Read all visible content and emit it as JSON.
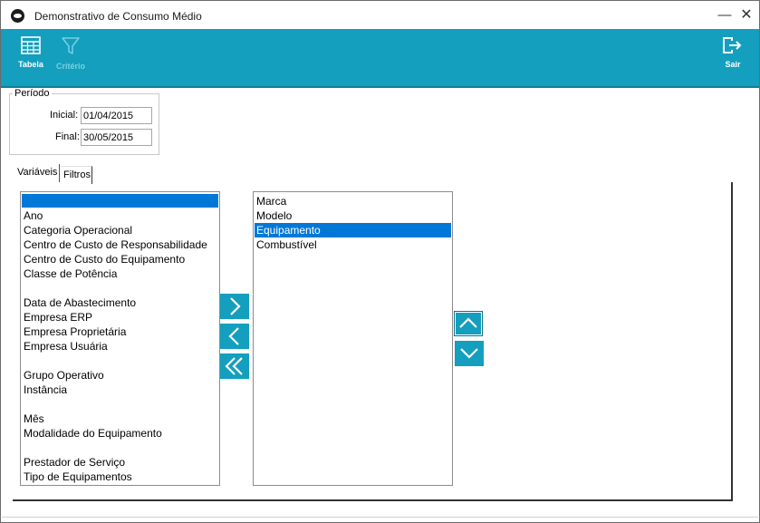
{
  "window": {
    "title": "Demonstrativo de Consumo Médio"
  },
  "toolbar": {
    "tabela_label": "Tabela",
    "criterio_label": "Critério",
    "sair_label": "Sair",
    "accent_color": "#139fbd"
  },
  "periodo": {
    "legend": "Período",
    "inicial_label": "Inicial:",
    "inicial_value": "01/04/2015",
    "final_label": "Final:",
    "final_value": "30/05/2015"
  },
  "tabs": [
    {
      "label": "Variáveis"
    },
    {
      "label": "Filtros"
    }
  ],
  "available_list": {
    "items": [
      "",
      "Ano",
      "Categoria Operacional",
      "Centro de Custo de Responsabilidade",
      "Centro de Custo do Equipamento",
      "Classe de Potência",
      "",
      "Data de Abastecimento",
      "Empresa ERP",
      "Empresa Proprietária",
      "Empresa Usuária",
      "",
      "Grupo Operativo",
      "Instância",
      "",
      "Mês",
      "Modalidade do Equipamento",
      "",
      "Prestador de Serviço",
      "Tipo de Equipamentos"
    ],
    "selected_index": 0
  },
  "selected_list": {
    "items": [
      "Marca",
      "Modelo",
      "Equipamento",
      "Combustível"
    ],
    "selected_index": 2
  },
  "icons": {
    "tabela": "table-icon",
    "criterio": "filter-icon",
    "sair": "exit-icon",
    "move_right": "chevron-right-icon",
    "move_left": "chevron-left-icon",
    "move_all_left": "double-chevron-left-icon",
    "move_up": "chevron-up-icon",
    "move_down": "chevron-down-icon"
  }
}
